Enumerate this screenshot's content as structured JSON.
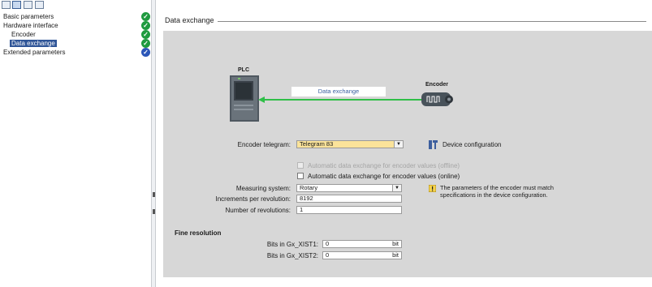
{
  "nav": {
    "items": [
      {
        "label": "Basic parameters",
        "status": "ok"
      },
      {
        "label": "Hardware interface",
        "status": "ok"
      },
      {
        "label": "Encoder",
        "status": "ok"
      },
      {
        "label": "Data exchange",
        "status": "ok",
        "selected": true
      },
      {
        "label": "Extended parameters",
        "status": "info"
      }
    ]
  },
  "section": {
    "title": "Data exchange"
  },
  "diagram": {
    "plc_label": "PLC",
    "link_label": "Data exchange",
    "encoder_label": "Encoder",
    "link_color": "#2fbf48"
  },
  "form": {
    "encoder_telegram": {
      "label": "Encoder telegram:",
      "value": "Telegram 83"
    },
    "device_configuration_label": "Device configuration",
    "auto_offline_label": "Automatic data exchange for encoder values (offline)",
    "auto_online_label": "Automatic data exchange for encoder values (online)",
    "measuring_system": {
      "label": "Measuring system:",
      "value": "Rotary"
    },
    "increments": {
      "label": "Increments per revolution:",
      "value": "8192"
    },
    "revolutions": {
      "label": "Number of revolutions:",
      "value": "1"
    },
    "warning_text": "The parameters of the encoder must match specifications in the device configuration."
  },
  "fine_resolution": {
    "title": "Fine resolution",
    "xist1": {
      "label": "Bits in Gx_XIST1:",
      "value": "0",
      "unit": "bit"
    },
    "xist2": {
      "label": "Bits in Gx_XIST2:",
      "value": "0",
      "unit": "bit"
    }
  },
  "colors": {
    "selected": "#2f5597",
    "ok": "#1f9a3f",
    "info": "#2b56b8",
    "telegram_field": "#fbe39a"
  }
}
